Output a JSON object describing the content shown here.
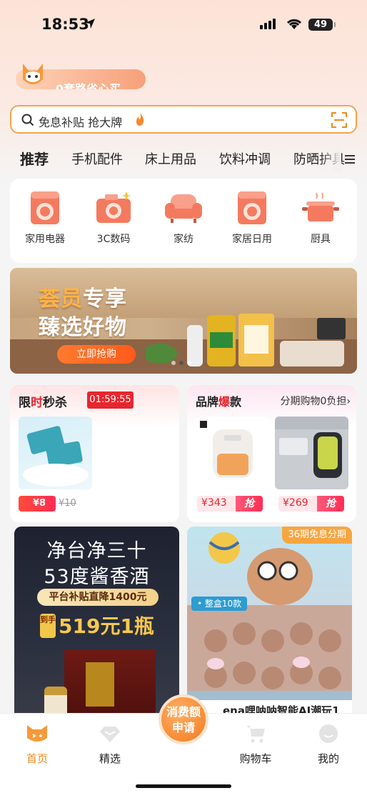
{
  "status_bar": {
    "time": "18:53",
    "battery": "49"
  },
  "promo": {
    "text": "0套路省心买"
  },
  "search": {
    "placeholder": "免息补贴 抢大牌"
  },
  "tabs": [
    {
      "label": "推荐",
      "active": true
    },
    {
      "label": "手机配件"
    },
    {
      "label": "床上用品"
    },
    {
      "label": "饮料冲调"
    },
    {
      "label": "防晒护具"
    }
  ],
  "categories": [
    {
      "label": "家用电器",
      "icon": "washer-icon"
    },
    {
      "label": "3C数码",
      "icon": "camera-icon"
    },
    {
      "label": "家纺",
      "icon": "sofa-icon"
    },
    {
      "label": "家居日用",
      "icon": "washer-icon"
    },
    {
      "label": "厨具",
      "icon": "pot-icon"
    }
  ],
  "banner": {
    "title_hl": "荟员",
    "title_rest": "专享",
    "subtitle": "臻选好物",
    "button": "立即抢购"
  },
  "flash_sale": {
    "title_a": "限",
    "title_b": "时",
    "title_c": "秒杀",
    "countdown": "01:59:55",
    "price": "¥8",
    "original_price": "¥10"
  },
  "brand_deals": {
    "title_a": "品牌",
    "title_b": "爆",
    "title_c": "款",
    "subtitle": "分期购物0负担›",
    "products": [
      {
        "price": "¥343",
        "grab": "抢"
      },
      {
        "price": "¥269",
        "grab": "抢"
      }
    ]
  },
  "feed": {
    "left": {
      "line1": "净台净三十",
      "line2": "53度酱香酒",
      "subsidy": "平台补贴直降1400元",
      "deal_tag": "到手",
      "deal": "519元1瓶"
    },
    "right": {
      "installment": "36期免息分期",
      "box_tag": "• 整盒10款",
      "caption": "ena哩呐呐智能AI潮玩1"
    }
  },
  "bottom_nav": {
    "items": [
      {
        "label": "首页",
        "active": true
      },
      {
        "label": "精选"
      },
      {
        "label": "购物车"
      },
      {
        "label": "我的"
      }
    ],
    "center": "消费额申请"
  },
  "colors": {
    "accent": "#f08a1c",
    "sale_red": "#e8262e"
  }
}
